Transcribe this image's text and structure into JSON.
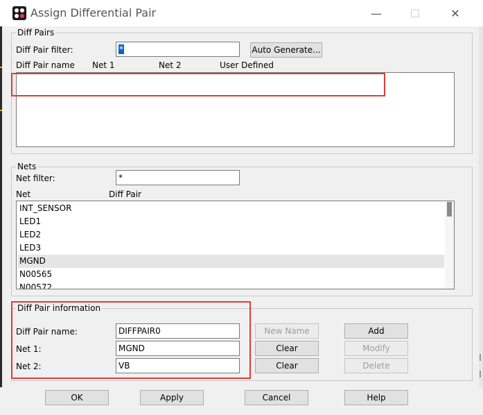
{
  "window": {
    "title": "Assign Differential Pair"
  },
  "diff_pairs": {
    "legend": "Diff Pairs",
    "filter_label": "Diff Pair filter:",
    "filter_value": "*",
    "auto_generate": "Auto Generate...",
    "columns": [
      "Diff Pair name",
      "Net 1",
      "Net 2",
      "User Defined"
    ]
  },
  "nets": {
    "legend": "Nets",
    "filter_label": "Net filter:",
    "filter_value": "*",
    "columns": [
      "Net",
      "Diff Pair"
    ],
    "items": [
      "INT_SENSOR",
      "LED1",
      "LED2",
      "LED3",
      "MGND",
      "N00565",
      "N00572"
    ],
    "selected": "MGND"
  },
  "info": {
    "legend": "Diff Pair information",
    "name_label": "Diff Pair name:",
    "name_value": "DIFFPAIR0",
    "net1_label": "Net 1:",
    "net1_value": "MGND",
    "net2_label": "Net 2:",
    "net2_value": "VB",
    "new_name": "New Name",
    "clear1": "Clear",
    "clear2": "Clear",
    "add": "Add",
    "modify": "Modify",
    "delete": "Delete"
  },
  "footer": {
    "ok": "OK",
    "apply": "Apply",
    "cancel": "Cancel",
    "help": "Help"
  },
  "colors": {
    "highlight": "#e03a3a",
    "selection": "#0a64c8"
  }
}
